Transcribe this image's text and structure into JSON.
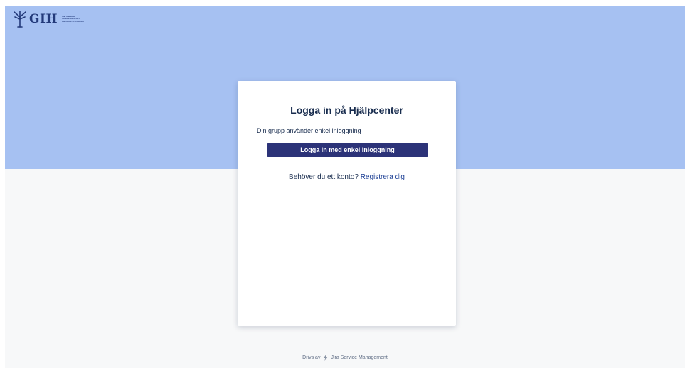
{
  "header": {
    "logo": {
      "text": "GIH",
      "subtitle_lines": [
        "THE SWEDISH",
        "SCHOOL OF SPORT",
        "AND HEALTH SCIENCES"
      ],
      "icon": "gih-tree-logo-icon"
    }
  },
  "login_card": {
    "title": "Logga in på Hjälpcenter",
    "subtitle": "Din grupp använder enkel inloggning",
    "sso_button_label": "Logga in med enkel inloggning",
    "signup_prompt": "Behöver du ett konto?",
    "signup_link": "Registrera dig"
  },
  "footer": {
    "prefix": "Drivs av",
    "product": "Jira Service Management",
    "icon": "jira-lightning-icon"
  },
  "colors": {
    "banner": "#a6c1f2",
    "page_background": "#f7f8f9",
    "button": "#2c3378",
    "link": "#1c3f94",
    "text": "#172b4d"
  }
}
